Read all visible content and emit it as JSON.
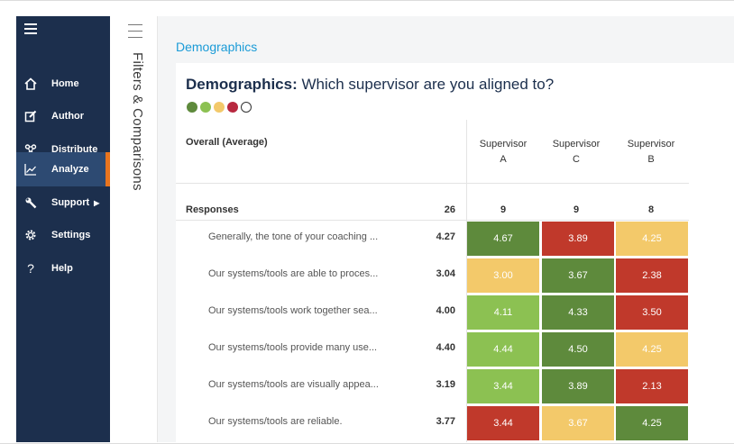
{
  "sidebar": {
    "items": [
      {
        "label": "Home",
        "icon": "home-icon",
        "glyph": "⌂"
      },
      {
        "label": "Author",
        "icon": "edit-icon",
        "glyph": "✎"
      },
      {
        "label": "Distribute",
        "icon": "share-icon",
        "glyph": "⟲"
      },
      {
        "label": "Analyze",
        "icon": "chart-line-icon",
        "glyph": "⟋"
      },
      {
        "label": "Support",
        "icon": "wrench-icon",
        "glyph": "✱"
      },
      {
        "label": "Settings",
        "icon": "gear-icon",
        "glyph": "⚙"
      },
      {
        "label": "Help",
        "icon": "question-icon",
        "glyph": "?"
      }
    ],
    "active": "Analyze"
  },
  "filters": {
    "label": "Filters & Comparisons"
  },
  "breadcrumb": "Demographics",
  "card": {
    "title_bold": "Demographics:",
    "title_rest": " Which supervisor are you aligned to?",
    "legend_dots": [
      "#5e8a3c",
      "#8cc152",
      "#f3c96a",
      "#b8283f",
      "#ffffff"
    ],
    "overall_label": "Overall (Average)",
    "columns": [
      {
        "line1": "Supervisor",
        "line2": "A"
      },
      {
        "line1": "Supervisor",
        "line2": "C"
      },
      {
        "line1": "Supervisor",
        "line2": "B"
      }
    ],
    "responses": {
      "label": "Responses",
      "overall": "26",
      "values": [
        "9",
        "9",
        "8"
      ]
    },
    "rows": [
      {
        "label": "Generally, the tone of your coaching ...",
        "overall": "4.27",
        "values": [
          "4.67",
          "3.89",
          "4.25"
        ],
        "colors": [
          "#5e8a3c",
          "#c0392b",
          "#f3c96a"
        ]
      },
      {
        "label": "Our systems/tools are able to proces...",
        "overall": "3.04",
        "values": [
          "3.00",
          "3.67",
          "2.38"
        ],
        "colors": [
          "#f3c96a",
          "#5e8a3c",
          "#c0392b"
        ]
      },
      {
        "label": "Our systems/tools work together sea...",
        "overall": "4.00",
        "values": [
          "4.11",
          "4.33",
          "3.50"
        ],
        "colors": [
          "#8cc152",
          "#5e8a3c",
          "#c0392b"
        ]
      },
      {
        "label": "Our systems/tools provide many use...",
        "overall": "4.40",
        "values": [
          "4.44",
          "4.50",
          "4.25"
        ],
        "colors": [
          "#8cc152",
          "#5e8a3c",
          "#f3c96a"
        ]
      },
      {
        "label": "Our systems/tools are visually appea...",
        "overall": "3.19",
        "values": [
          "3.44",
          "3.89",
          "2.13"
        ],
        "colors": [
          "#8cc152",
          "#5e8a3c",
          "#c0392b"
        ]
      },
      {
        "label": "Our systems/tools are reliable.",
        "overall": "3.77",
        "values": [
          "3.44",
          "3.67",
          "4.25"
        ],
        "colors": [
          "#c0392b",
          "#f3c96a",
          "#5e8a3c"
        ]
      }
    ]
  }
}
